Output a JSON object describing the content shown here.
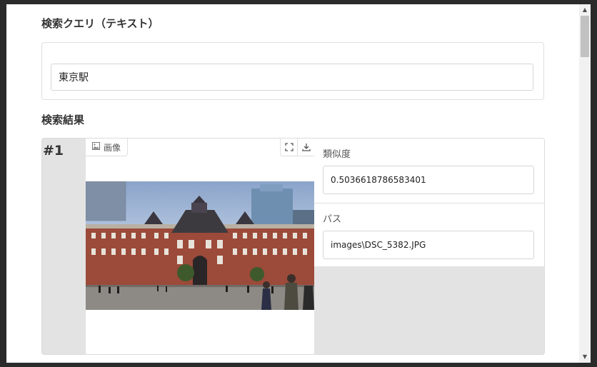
{
  "query_section": {
    "heading": "検索クエリ（テキスト）",
    "value": "東京駅"
  },
  "results_section": {
    "heading": "検索結果",
    "results": [
      {
        "rank": "#1",
        "image_tab_label": "画像",
        "similarity_label": "類似度",
        "similarity_value": "0.5036618786583401",
        "path_label": "パス",
        "path_value": "images\\DSC_5382.JPG"
      }
    ]
  },
  "icons": {
    "image_tab": "image-icon",
    "fullscreen": "fullscreen-icon",
    "download": "download-icon",
    "scroll_up": "scroll-up-arrow",
    "scroll_down": "scroll-down-arrow"
  },
  "colors": {
    "card_background": "#e3e3e3",
    "field_border": "#d6d6d6",
    "frame_background": "#ffffff"
  }
}
